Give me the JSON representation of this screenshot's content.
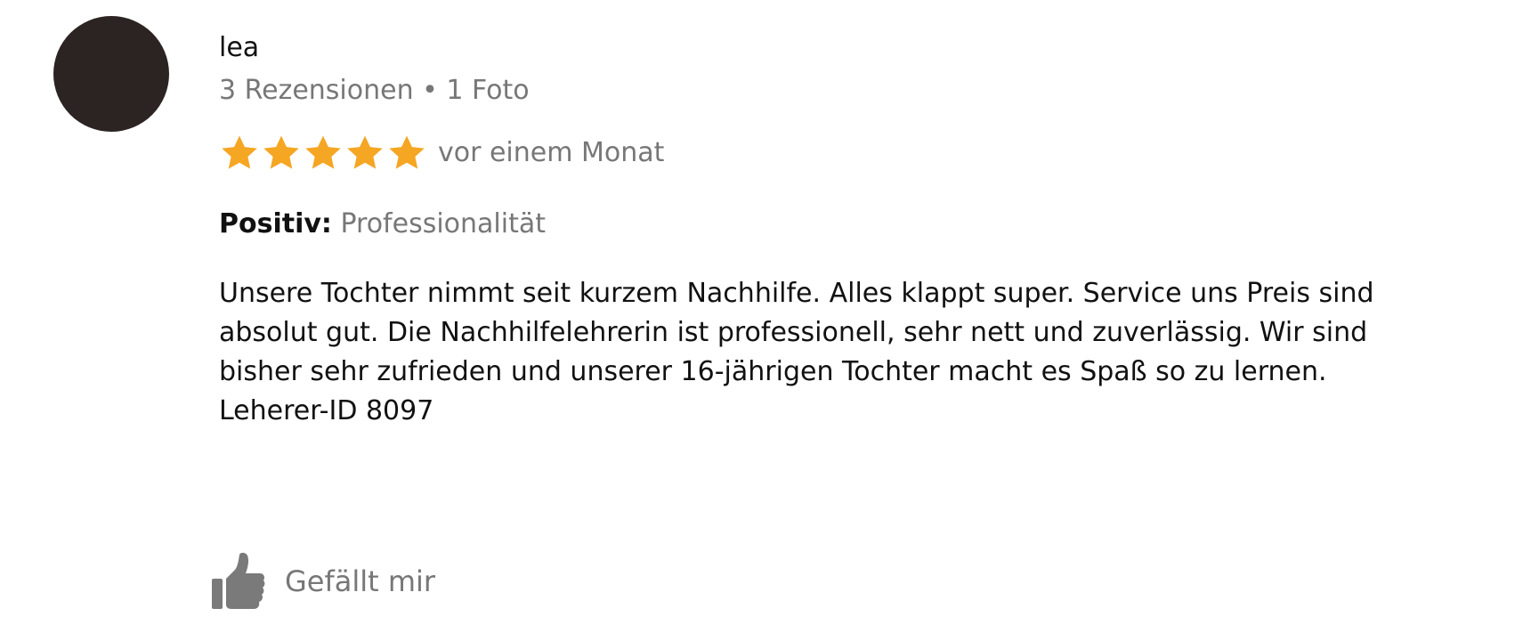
{
  "review": {
    "author": {
      "name": "lea",
      "meta": "3 Rezensionen • 1 Foto"
    },
    "rating": {
      "stars": 5,
      "max": 5,
      "time": "vor einem Monat"
    },
    "highlight": {
      "label": "Positiv:",
      "value": "Professionalität"
    },
    "text_lines": [
      "Unsere Tochter nimmt seit kurzem Nachhilfe. Alles klappt super. Service uns Preis sind",
      "absolut gut. Die Nachhilfelehrerin ist professionell, sehr nett und zuverlässig. Wir sind",
      "bisher sehr zufrieden und unserer 16-jährigen Tochter macht es Spaß so zu lernen.",
      "Leherer-ID 8097"
    ],
    "like": {
      "label": "Gefällt mir",
      "icon": "thumbs-up-icon"
    },
    "colors": {
      "avatar": "#2c2422",
      "star": "#f5a623",
      "muted_text": "#777777",
      "icon": "#7a7a7a"
    }
  }
}
